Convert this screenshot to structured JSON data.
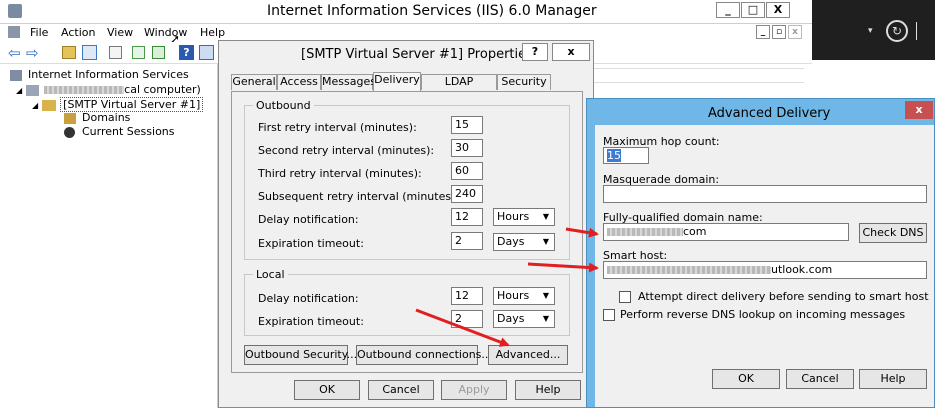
{
  "mmc": {
    "title": "Internet Information Services (IIS) 6.0 Manager",
    "menu": [
      "File",
      "Action",
      "View",
      "Window",
      "Help"
    ],
    "tree": {
      "root": "Internet Information Services",
      "computer_suffix": "cal computer)",
      "server": "[SMTP Virtual Server #1]",
      "domains": "Domains",
      "sessions": "Current Sessions"
    }
  },
  "properties": {
    "title": "[SMTP Virtual Server #1] Properties",
    "help_glyph": "?",
    "close_glyph": "x",
    "tabs": [
      "General",
      "Access",
      "Messages",
      "Delivery",
      "LDAP Routing",
      "Security"
    ],
    "active_tab": "Delivery",
    "outbound": {
      "title": "Outbound",
      "first_retry_label": "First retry interval (minutes):",
      "first_retry_value": "15",
      "second_retry_label": "Second retry interval (minutes):",
      "second_retry_value": "30",
      "third_retry_label": "Third retry interval (minutes):",
      "third_retry_value": "60",
      "subsequent_label": "Subsequent retry interval (minutes):",
      "subsequent_value": "240",
      "delay_label": "Delay notification:",
      "delay_value": "12",
      "delay_unit": "Hours",
      "expiration_label": "Expiration timeout:",
      "expiration_value": "2",
      "expiration_unit": "Days"
    },
    "local": {
      "title": "Local",
      "delay_label": "Delay notification:",
      "delay_value": "12",
      "delay_unit": "Hours",
      "expiration_label": "Expiration timeout:",
      "expiration_value": "2",
      "expiration_unit": "Days"
    },
    "buttons": {
      "outbound_security": "Outbound Security...",
      "outbound_connections": "Outbound connections...",
      "advanced": "Advanced...",
      "ok": "OK",
      "cancel": "Cancel",
      "apply": "Apply",
      "help": "Help"
    }
  },
  "advanced": {
    "title": "Advanced Delivery",
    "close_glyph": "x",
    "max_hop_label": "Maximum hop count:",
    "max_hop_value": "15",
    "masquerade_label": "Masquerade domain:",
    "masquerade_value": "",
    "fqdn_label": "Fully-qualified domain name:",
    "fqdn_value_suffix": "com",
    "check_dns": "Check DNS",
    "smart_host_label": "Smart host:",
    "smart_host_suffix": "utlook.com",
    "attempt_direct_label": "Attempt direct delivery before sending to smart host",
    "attempt_direct_checked": false,
    "reverse_dns_label": "Perform reverse DNS lookup on incoming messages",
    "reverse_dns_checked": false,
    "ok": "OK",
    "cancel": "Cancel",
    "help": "Help"
  },
  "colors": {
    "dark_panel": "#1f1f1f",
    "adv_border": "#6fb7e6",
    "close_red": "#c75050",
    "arrow_red": "#e02020"
  }
}
